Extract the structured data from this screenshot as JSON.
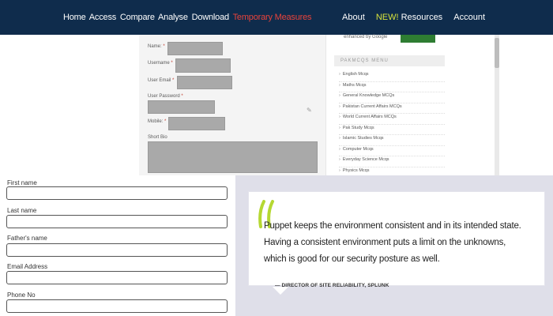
{
  "nav": {
    "left_items": [
      "Home",
      "Access",
      "Compare",
      "Analyse",
      "Download"
    ],
    "highlight_item": "Temporary Measures",
    "new_badge": "NEW!",
    "right_items": [
      "About",
      "Resources",
      "Account"
    ]
  },
  "registration": {
    "fields": [
      {
        "label": "Name:",
        "required": "*"
      },
      {
        "label": "Username",
        "required": "*"
      },
      {
        "label": "User Email",
        "required": "*"
      },
      {
        "label": "User Password",
        "required": "*"
      },
      {
        "label": "Mobile:",
        "required": "*"
      },
      {
        "label": "Short Bio",
        "required": ""
      }
    ]
  },
  "sidebar": {
    "search_placeholder": "enhanced by Google",
    "menu_heading": "PAKMCQS MENU",
    "menu_items": [
      "English Mcqs",
      "Maths Mcqs",
      "General Knowledge MCQs",
      "Pakistan Current Affairs MCQs",
      "World Current Affairs MCQs",
      "Pak Study Mcqs",
      "Islamic Studies Mcqs",
      "Computer Mcqs",
      "Everyday Science Mcqs",
      "Physics Mcqs"
    ]
  },
  "form": {
    "fields": [
      "First name",
      "Last name",
      "Father's name",
      "Email Address",
      "Phone No"
    ]
  },
  "quote": {
    "text": "Puppet keeps the environment consistent and in its intended state. Having a consistent environment puts a limit on the unknowns, which is good for our security posture as well.",
    "attribution": "— DIRECTOR OF SITE RELIABILITY, SPLUNK",
    "accent_color": "#b5d832"
  }
}
